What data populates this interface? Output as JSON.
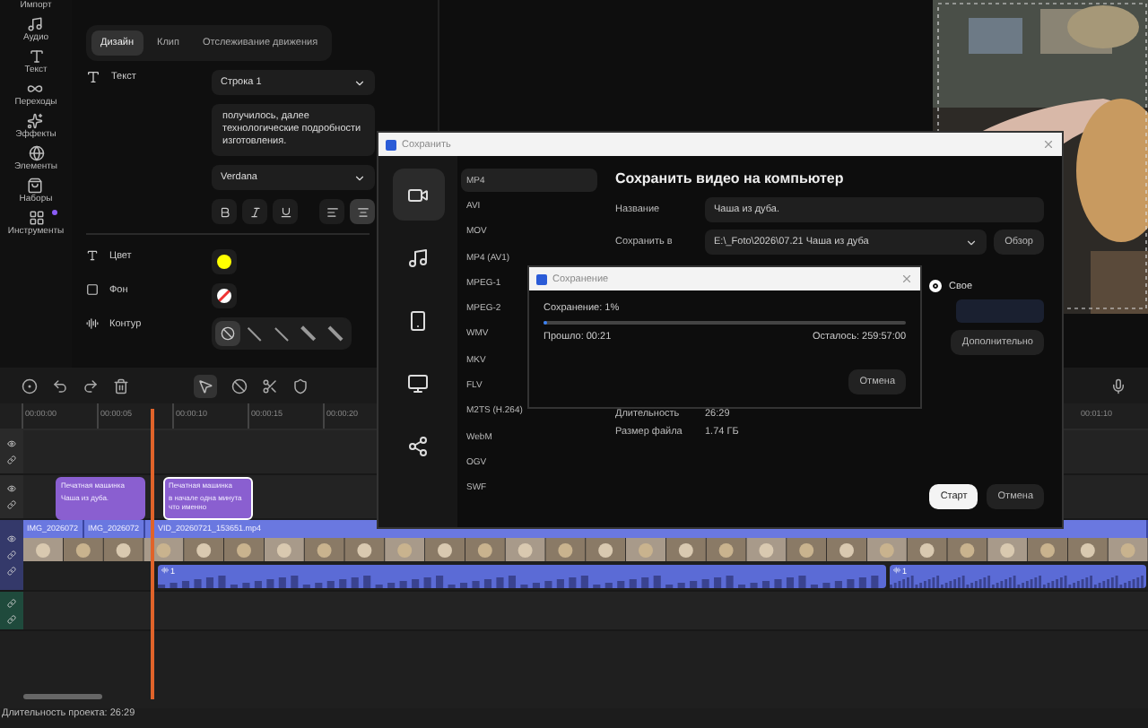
{
  "sidebar": {
    "items": [
      {
        "label": "Импорт",
        "badge": false
      },
      {
        "label": "Аудио",
        "badge": false
      },
      {
        "label": "Текст",
        "badge": false
      },
      {
        "label": "Переходы",
        "badge": false
      },
      {
        "label": "Эффекты",
        "badge": false
      },
      {
        "label": "Элементы",
        "badge": false
      },
      {
        "label": "Наборы",
        "badge": false
      },
      {
        "label": "Инструменты",
        "badge": true
      }
    ]
  },
  "properties": {
    "tabs": [
      {
        "label": "Дизайн",
        "selected": true
      },
      {
        "label": "Клип",
        "selected": false
      },
      {
        "label": "Отслеживание движения",
        "selected": false
      }
    ],
    "text_label": "Текст",
    "line_select": "Строка 1",
    "text_value": "получилось, далее технологические подробности изготовления.",
    "font": "Verdana",
    "format_buttons": [
      {
        "kind": "bold",
        "selected": false
      },
      {
        "kind": "italic",
        "selected": false
      },
      {
        "kind": "underline",
        "selected": false
      }
    ],
    "align_buttons": [
      {
        "kind": "left",
        "selected": false
      },
      {
        "kind": "center",
        "selected": true
      }
    ],
    "color": {
      "label": "Цвет",
      "color": "#ffff00"
    },
    "background": {
      "label": "Фон"
    },
    "outline": {
      "label": "Контур",
      "options": [
        {
          "kind": "none",
          "selected": true
        },
        {
          "kind": "thin",
          "selected": false
        },
        {
          "kind": "medium",
          "selected": false
        },
        {
          "kind": "thick",
          "selected": false
        },
        {
          "kind": "heavy",
          "selected": false
        }
      ]
    }
  },
  "timeline": {
    "ruler": [
      "00:00:00",
      "00:00:05",
      "00:00:10",
      "00:00:15",
      "00:00:20"
    ],
    "ruler_right": "00:01:10",
    "text_clips": [
      {
        "title": "Печатная машинка",
        "text": "Чаша из дуба.",
        "selected": false
      },
      {
        "title": "Печатная машинка",
        "text": "в начале одна минута что именно",
        "selected": true
      }
    ],
    "video_clips": [
      "IMG_2026072",
      "IMG_2026072",
      "VID_20260721_153651.mp4"
    ],
    "audio_clips": [
      {
        "label": "1"
      },
      {
        "label": "1"
      }
    ]
  },
  "status_bar": "Длительность проекта: 26:29",
  "save_dialog": {
    "title": "Сохранить",
    "categories": [
      {
        "kind": "video",
        "selected": true
      },
      {
        "kind": "audio",
        "selected": false
      },
      {
        "kind": "device",
        "selected": false
      },
      {
        "kind": "tv",
        "selected": false
      },
      {
        "kind": "share",
        "selected": false
      }
    ],
    "formats": [
      {
        "label": "MP4",
        "selected": true
      },
      {
        "label": "AVI",
        "selected": false
      },
      {
        "label": "MOV",
        "selected": false
      },
      {
        "label": "MP4 (AV1)",
        "selected": false
      },
      {
        "label": "MPEG-1",
        "selected": false
      },
      {
        "label": "MPEG-2",
        "selected": false
      },
      {
        "label": "WMV",
        "selected": false
      },
      {
        "label": "MKV",
        "selected": false
      },
      {
        "label": "FLV",
        "selected": false
      },
      {
        "label": "M2TS (H.264)",
        "selected": false
      },
      {
        "label": "WebM",
        "selected": false
      },
      {
        "label": "OGV",
        "selected": false
      },
      {
        "label": "SWF",
        "selected": false
      }
    ],
    "heading": "Сохранить видео на компьютер",
    "name_label": "Название",
    "name_value": "Чаша из дуба.",
    "path_label": "Сохранить в",
    "path_value": "E:\\_Foto\\2026\\07.21 Чаша из дуба",
    "browse": "Обзор",
    "quality": [
      {
        "label": "Свое",
        "selected": true
      }
    ],
    "advanced": "Дополнительно",
    "info": [
      {
        "label": "Длительность",
        "value": "26:29"
      },
      {
        "label": "Размер файла",
        "value": "1.74 ГБ"
      }
    ],
    "start": "Старт",
    "cancel": "Отмена"
  },
  "progress_dialog": {
    "title": "Сохранение",
    "status_label": "Сохранение:",
    "percent": "1%",
    "level": 0.01,
    "elapsed_label": "Прошло:",
    "elapsed": "00:21",
    "remaining_label": "Осталось:",
    "remaining": "259:57:00",
    "cancel": "Отмена"
  }
}
